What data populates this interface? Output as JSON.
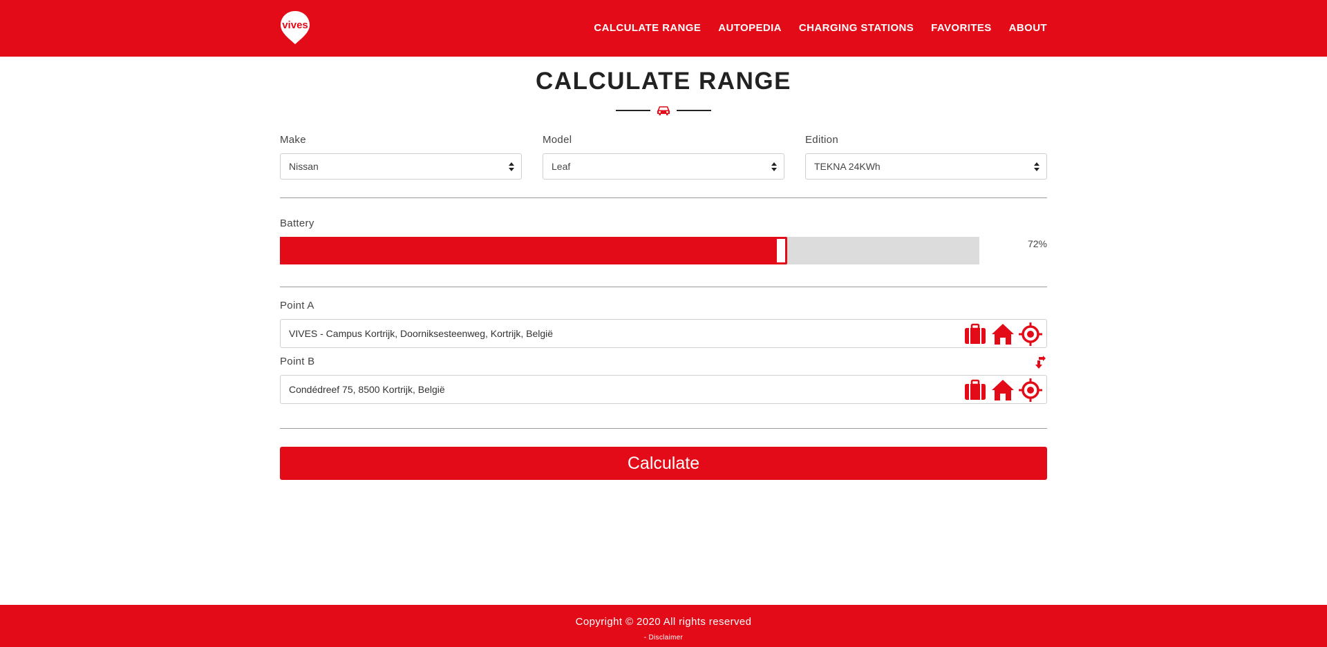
{
  "theme": {
    "accent": "#e20b17",
    "track": "#dcdcdc"
  },
  "brand": {
    "logo_text": "vives"
  },
  "nav": {
    "items": [
      {
        "label": "CALCULATE RANGE"
      },
      {
        "label": "AUTOPEDIA"
      },
      {
        "label": "CHARGING STATIONS"
      },
      {
        "label": "FAVORITES"
      },
      {
        "label": "ABOUT"
      }
    ]
  },
  "page": {
    "title": "CALCULATE RANGE",
    "title_icon": "car-icon"
  },
  "vehicle": {
    "make": {
      "label": "Make",
      "value": "Nissan"
    },
    "model": {
      "label": "Model",
      "value": "Leaf"
    },
    "edition": {
      "label": "Edition",
      "value": "TEKNA 24KWh"
    }
  },
  "battery": {
    "label": "Battery",
    "percent": 72,
    "display": "72%"
  },
  "route": {
    "point_a": {
      "label": "Point A",
      "value": "VIVES - Campus Kortrijk, Doorniksesteenweg, Kortrijk, België"
    },
    "point_b": {
      "label": "Point B",
      "value": "Condédreef 75, 8500 Kortrijk, België"
    },
    "icons": [
      "briefcase-icon",
      "home-icon",
      "location-target-icon"
    ],
    "swap_icon": "swap-icon"
  },
  "actions": {
    "calculate_label": "Calculate"
  },
  "footer": {
    "copyright": "Copyright © 2020 All rights reserved",
    "disclaimer": "- Disclaimer"
  }
}
